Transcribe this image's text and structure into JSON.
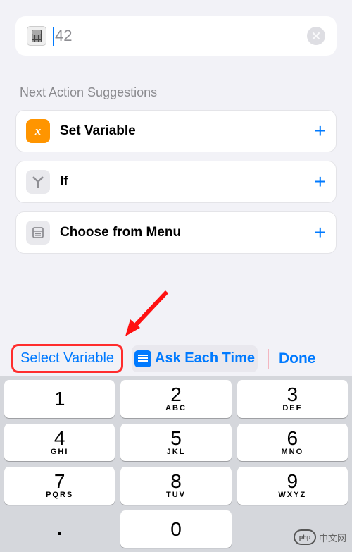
{
  "input": {
    "value": "42"
  },
  "section_header": "Next Action Suggestions",
  "suggestions": [
    {
      "icon": "x",
      "label": "Set Variable"
    },
    {
      "icon": "Y",
      "label": "If"
    },
    {
      "icon": "menu",
      "label": "Choose from Menu"
    }
  ],
  "toolbar": {
    "select_variable": "Select Variable",
    "ask_each_time": "Ask Each Time",
    "done": "Done"
  },
  "keypad": [
    {
      "num": "1",
      "letters": ""
    },
    {
      "num": "2",
      "letters": "ABC"
    },
    {
      "num": "3",
      "letters": "DEF"
    },
    {
      "num": "4",
      "letters": "GHI"
    },
    {
      "num": "5",
      "letters": "JKL"
    },
    {
      "num": "6",
      "letters": "MNO"
    },
    {
      "num": "7",
      "letters": "PQRS"
    },
    {
      "num": "8",
      "letters": "TUV"
    },
    {
      "num": "9",
      "letters": "WXYZ"
    },
    {
      "num": ".",
      "letters": "",
      "dim": true
    },
    {
      "num": "0",
      "letters": ""
    },
    {
      "num": "",
      "letters": "",
      "dim": true,
      "backspace": true
    }
  ],
  "watermark": "中文网"
}
